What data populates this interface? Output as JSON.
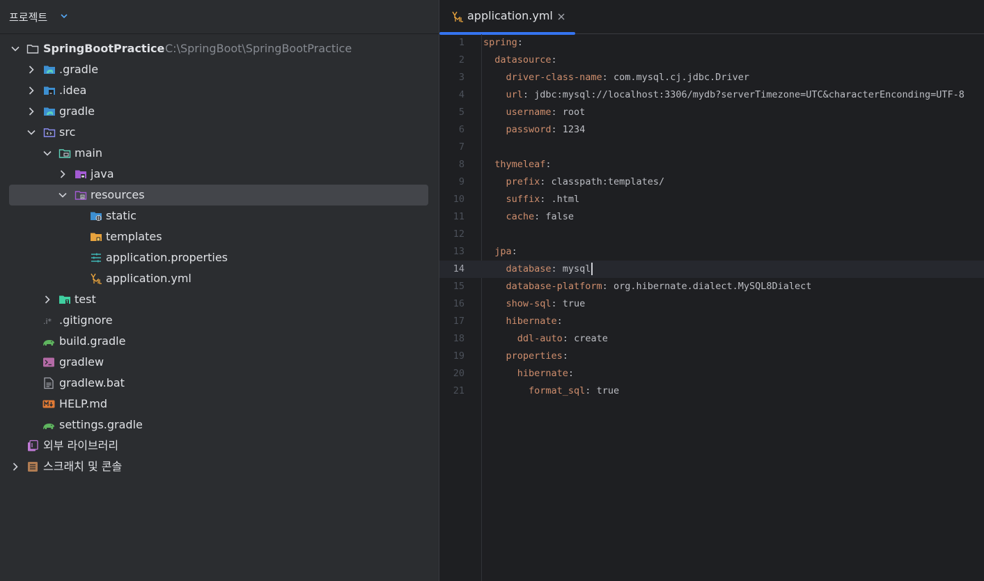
{
  "project_panel": {
    "title": "프로젝트",
    "tree": [
      {
        "label": "SpringBootPractice",
        "path": "C:\\SpringBoot\\SpringBootPractice",
        "icon": "project-folder-icon",
        "expanded": true,
        "depth": 0
      },
      {
        "label": ".gradle",
        "icon": "gradle-folder-icon",
        "expanded": false,
        "depth": 1
      },
      {
        "label": ".idea",
        "icon": "idea-folder-icon",
        "expanded": false,
        "depth": 1
      },
      {
        "label": "gradle",
        "icon": "gradle-folder-icon",
        "expanded": false,
        "depth": 1
      },
      {
        "label": "src",
        "icon": "source-folder-icon",
        "expanded": true,
        "depth": 1
      },
      {
        "label": "main",
        "icon": "module-folder-icon",
        "expanded": true,
        "depth": 2
      },
      {
        "label": "java",
        "icon": "java-source-folder-icon",
        "expanded": false,
        "depth": 3
      },
      {
        "label": "resources",
        "icon": "resources-folder-icon",
        "expanded": true,
        "depth": 3,
        "selected": true
      },
      {
        "label": "static",
        "icon": "web-folder-icon",
        "depth": 4
      },
      {
        "label": "templates",
        "icon": "templates-folder-icon",
        "depth": 4
      },
      {
        "label": "application.properties",
        "icon": "properties-file-icon",
        "depth": 4
      },
      {
        "label": "application.yml",
        "icon": "yaml-file-icon",
        "depth": 4
      },
      {
        "label": "test",
        "icon": "test-folder-icon",
        "expanded": false,
        "depth": 2
      },
      {
        "label": ".gitignore",
        "icon": "gitignore-file-icon",
        "depth": 1
      },
      {
        "label": "build.gradle",
        "icon": "gradle-elephant-icon",
        "depth": 1
      },
      {
        "label": "gradlew",
        "icon": "terminal-file-icon",
        "depth": 1
      },
      {
        "label": "gradlew.bat",
        "icon": "text-file-icon",
        "depth": 1
      },
      {
        "label": "HELP.md",
        "icon": "markdown-file-icon",
        "depth": 1
      },
      {
        "label": "settings.gradle",
        "icon": "gradle-elephant-icon",
        "depth": 1
      },
      {
        "label": "외부 라이브러리",
        "icon": "external-libraries-icon",
        "depth": 0
      },
      {
        "label": "스크래치 및 콘솔",
        "icon": "scratches-icon",
        "expanded": false,
        "depth": 0
      }
    ]
  },
  "editor": {
    "tab": {
      "label": "application.yml",
      "icon": "yaml-file-icon",
      "active": true
    },
    "current_line": 14,
    "lines": [
      {
        "n": "1",
        "key": "spring",
        "value": ""
      },
      {
        "n": "2",
        "key": "datasource",
        "value": ""
      },
      {
        "n": "3",
        "key": "driver-class-name",
        "value": "com.mysql.cj.jdbc.Driver"
      },
      {
        "n": "4",
        "key": "url",
        "value": "jdbc:mysql://localhost:3306/mydb?serverTimezone=UTC&characterEnconding=UTF-8"
      },
      {
        "n": "5",
        "key": "username",
        "value": "root"
      },
      {
        "n": "6",
        "key": "password",
        "value": "1234"
      },
      {
        "n": "7",
        "key": "",
        "value": ""
      },
      {
        "n": "8",
        "key": "thymeleaf",
        "value": ""
      },
      {
        "n": "9",
        "key": "prefix",
        "value": "classpath:templates/"
      },
      {
        "n": "10",
        "key": "suffix",
        "value": ".html"
      },
      {
        "n": "11",
        "key": "cache",
        "value": "false"
      },
      {
        "n": "12",
        "key": "",
        "value": ""
      },
      {
        "n": "13",
        "key": "jpa",
        "value": ""
      },
      {
        "n": "14",
        "key": "database",
        "value": "mysql"
      },
      {
        "n": "15",
        "key": "database-platform",
        "value": "org.hibernate.dialect.MySQL8Dialect"
      },
      {
        "n": "16",
        "key": "show-sql",
        "value": "true"
      },
      {
        "n": "17",
        "key": "hibernate",
        "value": ""
      },
      {
        "n": "18",
        "key": "ddl-auto",
        "value": "create"
      },
      {
        "n": "19",
        "key": "properties",
        "value": ""
      },
      {
        "n": "20",
        "key": "hibernate",
        "value": ""
      },
      {
        "n": "21",
        "key": "format_sql",
        "value": "true"
      }
    ]
  },
  "colors": {
    "panel_bg": "#2b2d30",
    "editor_bg": "#1e1f22",
    "yaml_key": "#cf8e6d",
    "yaml_value": "#bcbec4",
    "tab_underline": "#3574f0",
    "path_gray": "#868a91"
  }
}
